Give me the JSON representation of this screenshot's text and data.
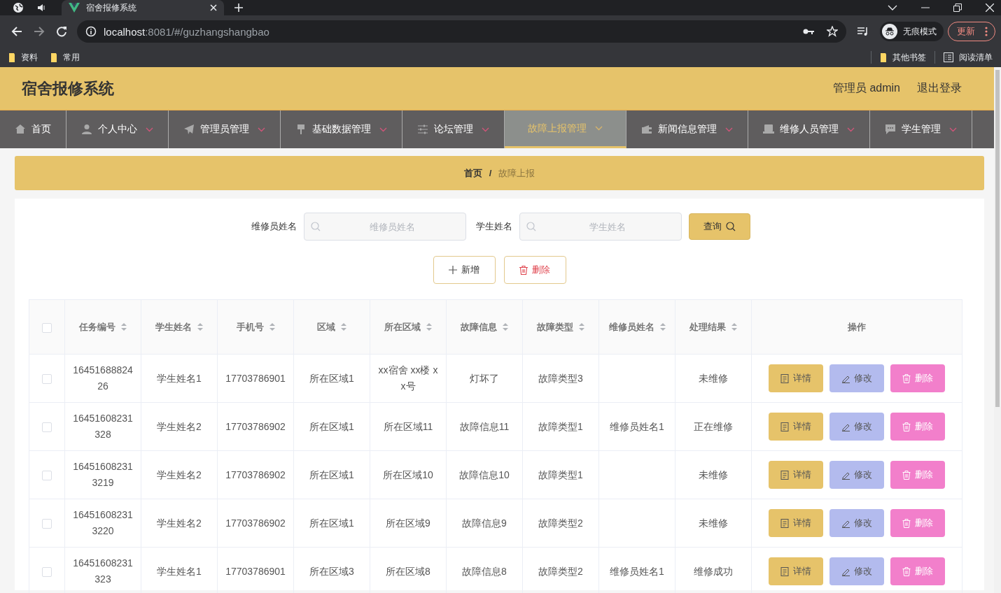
{
  "browser": {
    "tab_title": "宿舍报修系统",
    "url_host": "localhost",
    "url_path": ":8081/#/guzhangshangbao",
    "bookmarks": [
      "资料",
      "常用"
    ],
    "bookmarks_right": [
      "其他书签"
    ],
    "reading_list": "阅读清单",
    "incognito": "无痕模式",
    "update_button": "更新"
  },
  "header": {
    "title": "宿舍报修系统",
    "user": "管理员 admin",
    "logout": "退出登录"
  },
  "nav": [
    {
      "label": "首页",
      "selected": false,
      "dropdown": false
    },
    {
      "label": "个人中心",
      "selected": false,
      "dropdown": true
    },
    {
      "label": "管理员管理",
      "selected": false,
      "dropdown": true
    },
    {
      "label": "基础数据管理",
      "selected": false,
      "dropdown": true
    },
    {
      "label": "论坛管理",
      "selected": false,
      "dropdown": true
    },
    {
      "label": "故障上报管理",
      "selected": true,
      "dropdown": true
    },
    {
      "label": "新闻信息管理",
      "selected": false,
      "dropdown": true
    },
    {
      "label": "维修人员管理",
      "selected": false,
      "dropdown": true
    },
    {
      "label": "学生管理",
      "selected": false,
      "dropdown": true
    }
  ],
  "breadcrumb": {
    "items": [
      "首页",
      "故障上报"
    ],
    "separator": "/"
  },
  "search": {
    "fields": [
      {
        "label": "维修员姓名",
        "placeholder": "维修员姓名"
      },
      {
        "label": "学生姓名",
        "placeholder": "学生姓名"
      }
    ],
    "button": "查询"
  },
  "actions": [
    {
      "kind": "add",
      "label": "新增"
    },
    {
      "kind": "delete",
      "label": "删除"
    }
  ],
  "table": {
    "select_all_checked": false,
    "columns": [
      {
        "label": "任务编号",
        "sortable": true
      },
      {
        "label": "学生姓名",
        "sortable": true
      },
      {
        "label": "手机号",
        "sortable": true
      },
      {
        "label": "区域",
        "sortable": true
      },
      {
        "label": "所在区域",
        "sortable": true
      },
      {
        "label": "故障信息",
        "sortable": true
      },
      {
        "label": "故障类型",
        "sortable": true
      },
      {
        "label": "维修员姓名",
        "sortable": true
      },
      {
        "label": "处理结果",
        "sortable": true
      },
      {
        "label": "操作",
        "sortable": false
      }
    ],
    "rows": [
      {
        "checked": false,
        "cells": [
          "1645168882426",
          "学生姓名1",
          "17703786901",
          "所在区域1",
          "xx宿舍 xx楼 xx号",
          "灯坏了",
          "故障类型3",
          "",
          "未维修"
        ],
        "actions": [
          {
            "kind": "detail",
            "label": "详情"
          },
          {
            "kind": "edit",
            "label": "修改"
          },
          {
            "kind": "delete",
            "label": "删除"
          }
        ]
      },
      {
        "checked": false,
        "cells": [
          "16451608231328",
          "学生姓名2",
          "17703786902",
          "所在区域1",
          "所在区域11",
          "故障信息11",
          "故障类型1",
          "维修员姓名1",
          "正在维修"
        ],
        "actions": [
          {
            "kind": "detail",
            "label": "详情"
          },
          {
            "kind": "edit",
            "label": "修改"
          },
          {
            "kind": "delete",
            "label": "删除"
          }
        ]
      },
      {
        "checked": false,
        "cells": [
          "164516082313219",
          "学生姓名2",
          "17703786902",
          "所在区域1",
          "所在区域10",
          "故障信息10",
          "故障类型1",
          "",
          "未维修"
        ],
        "actions": [
          {
            "kind": "detail",
            "label": "详情"
          },
          {
            "kind": "edit",
            "label": "修改"
          },
          {
            "kind": "delete",
            "label": "删除"
          }
        ]
      },
      {
        "checked": false,
        "cells": [
          "164516082313220",
          "学生姓名2",
          "17703786902",
          "所在区域1",
          "所在区域9",
          "故障信息9",
          "故障类型2",
          "",
          "未维修"
        ],
        "actions": [
          {
            "kind": "detail",
            "label": "详情"
          },
          {
            "kind": "edit",
            "label": "修改"
          },
          {
            "kind": "delete",
            "label": "删除"
          }
        ]
      },
      {
        "checked": false,
        "cells": [
          "16451608231323",
          "学生姓名1",
          "17703786901",
          "所在区域3",
          "所在区域8",
          "故障信息8",
          "故障类型2",
          "维修员姓名1",
          "维修成功"
        ],
        "actions": [
          {
            "kind": "detail",
            "label": "详情"
          },
          {
            "kind": "edit",
            "label": "修改"
          },
          {
            "kind": "delete",
            "label": "删除"
          }
        ]
      }
    ]
  }
}
